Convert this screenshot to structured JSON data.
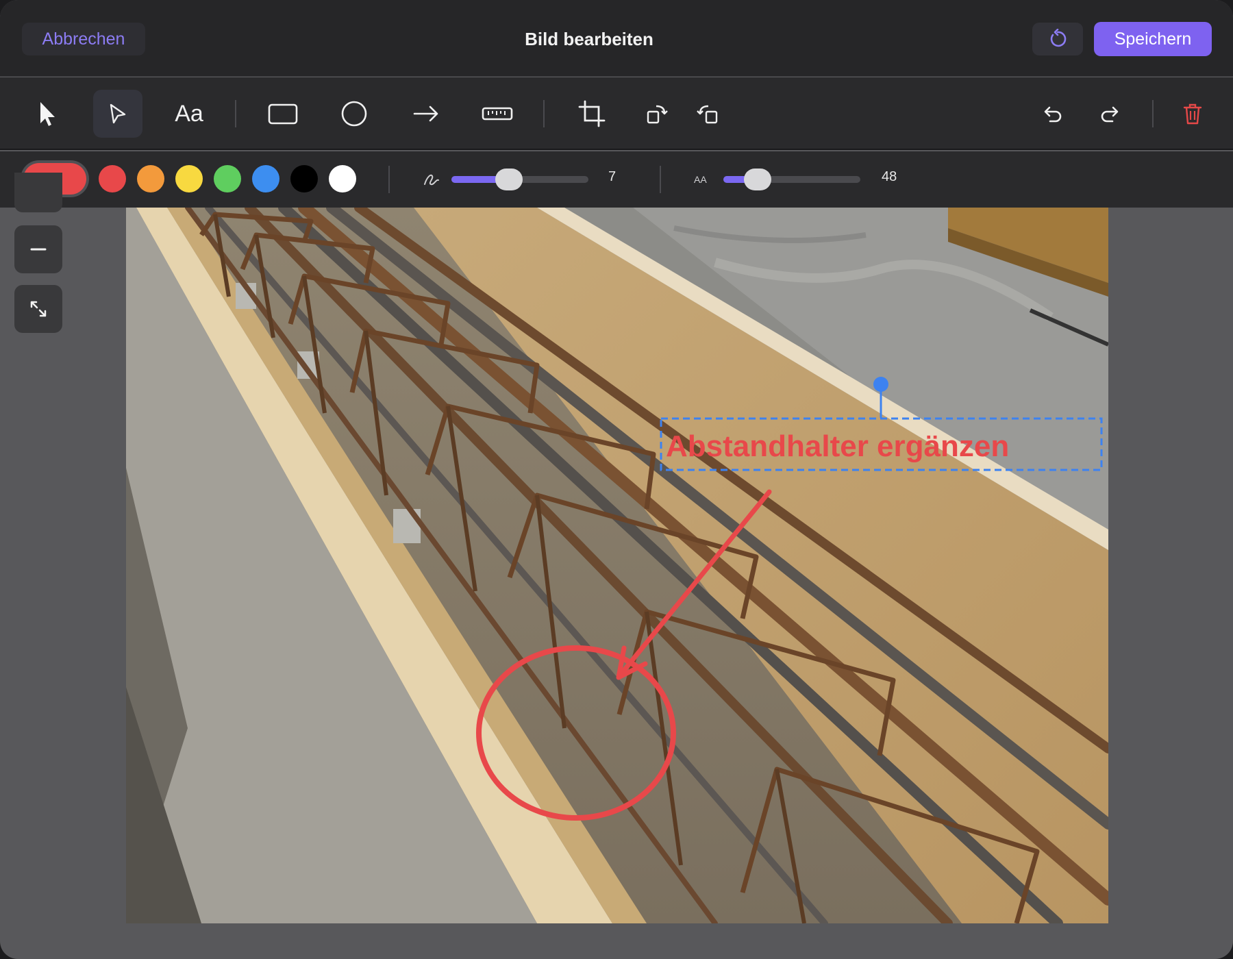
{
  "header": {
    "cancel_label": "Abbrechen",
    "title": "Bild bearbeiten",
    "save_label": "Speichern",
    "revert_icon": "revert-icon"
  },
  "toolbar": {
    "tools": [
      {
        "id": "select",
        "icon": "pointer-arrow-icon"
      },
      {
        "id": "pen",
        "icon": "pen-cursor-icon",
        "active": true
      },
      {
        "id": "text",
        "label": "Aa"
      },
      {
        "id": "rectangle",
        "icon": "rectangle-icon"
      },
      {
        "id": "ellipse",
        "icon": "circle-icon"
      },
      {
        "id": "arrow",
        "icon": "arrow-right-icon"
      },
      {
        "id": "measure",
        "icon": "ruler-icon"
      },
      {
        "id": "crop",
        "icon": "crop-icon"
      },
      {
        "id": "rotate-right",
        "icon": "rotate-right-icon"
      },
      {
        "id": "rotate-left",
        "icon": "rotate-left-icon"
      },
      {
        "id": "undo",
        "icon": "undo-icon"
      },
      {
        "id": "redo",
        "icon": "redo-icon"
      },
      {
        "id": "delete",
        "icon": "trash-icon"
      }
    ]
  },
  "style": {
    "current_color": "#e8484a",
    "colors": [
      "#e8484a",
      "#f39a3c",
      "#f8d940",
      "#5fce5f",
      "#3d8ef0",
      "#000000",
      "#ffffff"
    ],
    "stroke_width": "7",
    "stroke_fraction": 0.42,
    "font_size": "48",
    "font_fraction": 0.25,
    "font_size_icon_label": "AA"
  },
  "zoom": {
    "out_icon": "minus-icon",
    "fit_icon": "expand-icon"
  },
  "annotation": {
    "text": "Abstandhalter ergänzen",
    "color": "#e8484a",
    "selection_color": "#3d82f0"
  }
}
